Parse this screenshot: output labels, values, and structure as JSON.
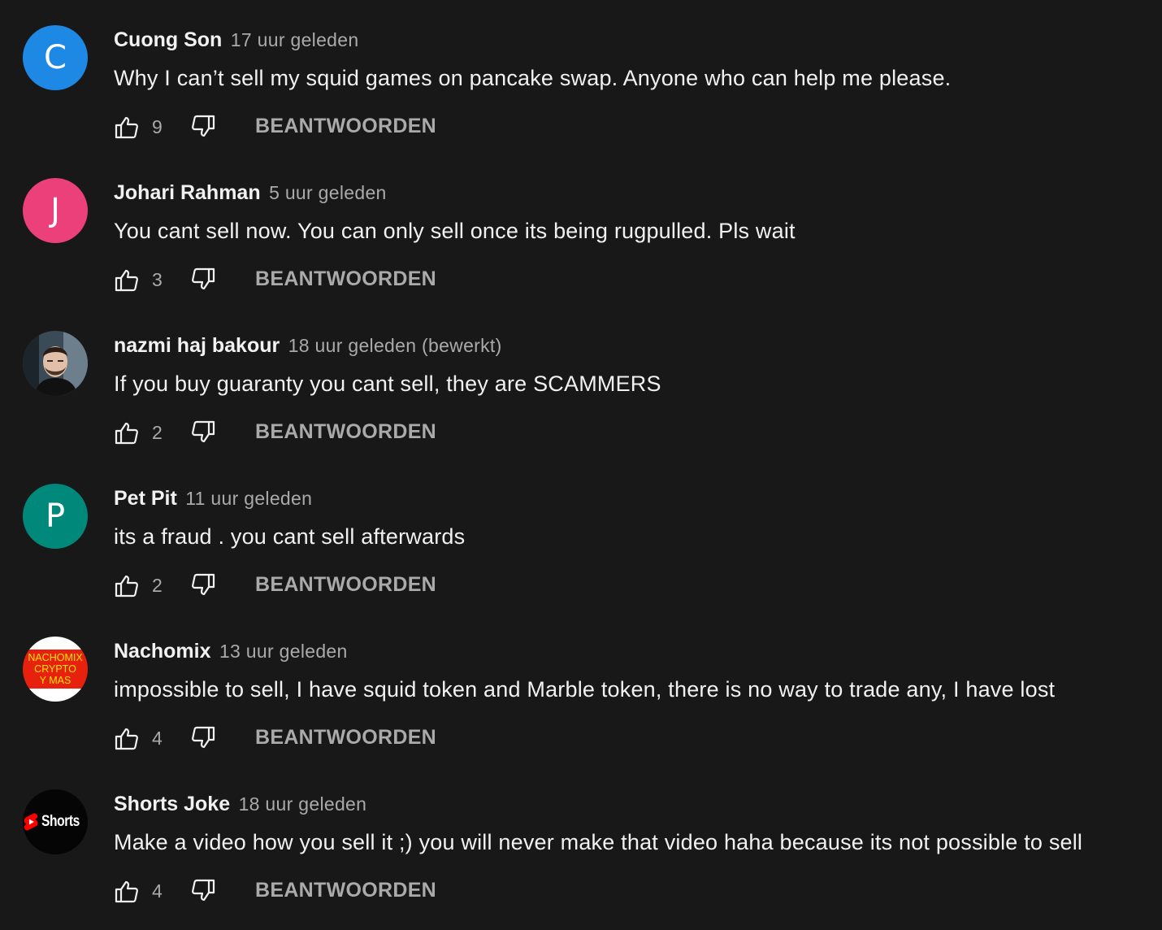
{
  "reply_label": "BEANTWOORDEN",
  "comments": [
    {
      "author": "Cuong Son",
      "time": "17 uur geleden",
      "text": "Why I can’t sell my squid games on pancake swap. Anyone who can help me please.",
      "likes": "9",
      "avatar": {
        "type": "letter",
        "letter": "C",
        "color": "#1e88e5"
      }
    },
    {
      "author": "Johari Rahman",
      "time": "5 uur geleden",
      "text": "You cant sell now. You can only sell once its being rugpulled. Pls wait",
      "likes": "3",
      "avatar": {
        "type": "letter",
        "letter": "J",
        "color": "#ec407a"
      }
    },
    {
      "author": "nazmi haj bakour",
      "time": "18 uur geleden (bewerkt)",
      "text": "If you buy guaranty you cant sell, they are SCAMMERS",
      "likes": "2",
      "avatar": {
        "type": "photo",
        "icon": "person-photo-icon"
      }
    },
    {
      "author": "Pet Pit",
      "time": "11 uur geleden",
      "text": "its a fraud . you cant sell afterwards",
      "likes": "2",
      "avatar": {
        "type": "letter",
        "letter": "P",
        "color": "#00897b"
      }
    },
    {
      "author": "Nachomix",
      "time": "13 uur geleden",
      "text": "impossible to sell, I have squid token and Marble token, there is no way to trade any, I have lost",
      "likes": "4",
      "avatar": {
        "type": "logo",
        "lines": [
          "NACHOMIX",
          "CRYPTO",
          "Y MAS"
        ]
      }
    },
    {
      "author": "Shorts Joke",
      "time": "18 uur geleden",
      "text": "Make a video how you sell it ;) you will never make that video haha because its not possible to sell",
      "likes": "4",
      "avatar": {
        "type": "shorts",
        "label": "Shorts",
        "icon": "shorts-logo-icon"
      }
    }
  ]
}
